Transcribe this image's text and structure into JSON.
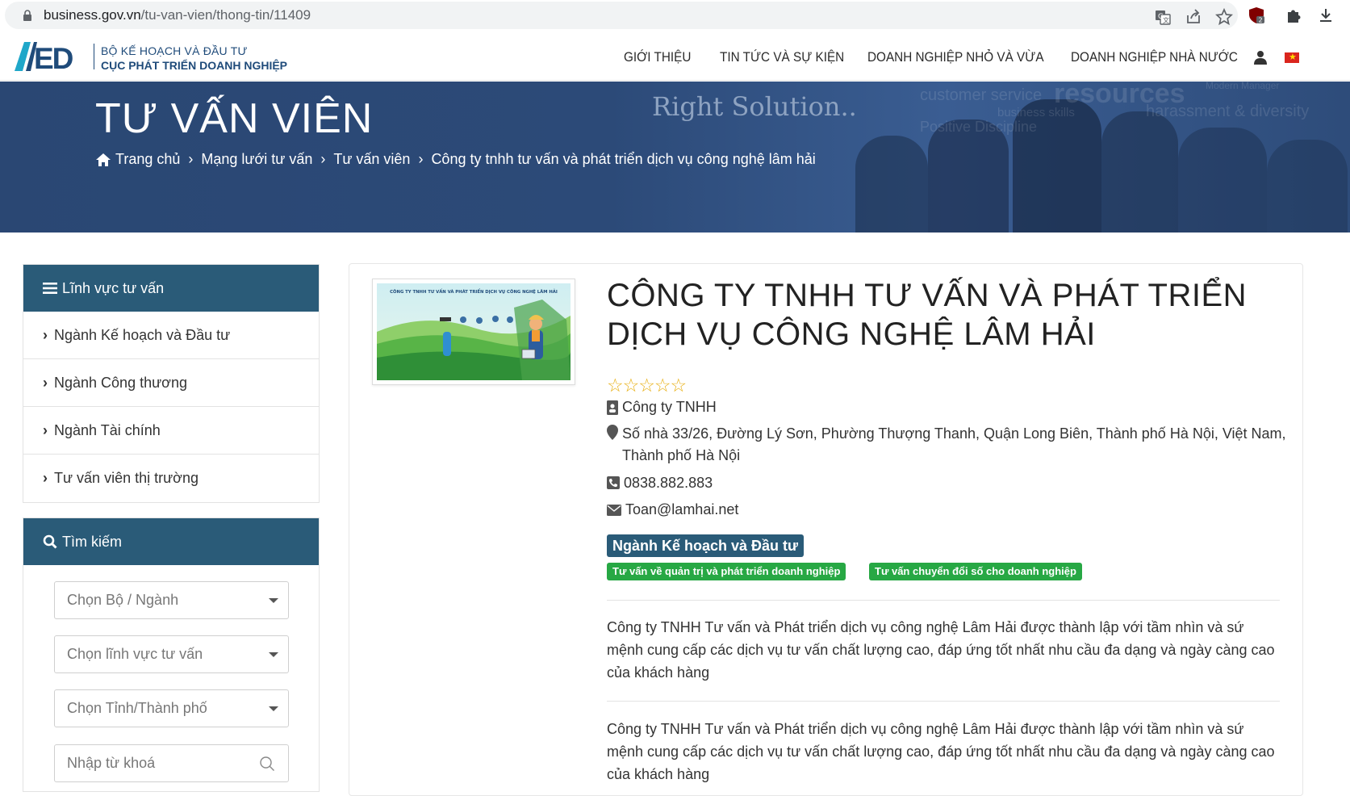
{
  "browser": {
    "url_host": "business.gov.vn",
    "url_path": "/tu-van-vien/thong-tin/11409"
  },
  "header": {
    "logo_line1": "BỘ KẾ HOẠCH VÀ ĐẦU TƯ",
    "logo_line2": "CỤC PHÁT TRIỂN DOANH NGHIỆP",
    "nav": [
      "GIỚI THIỆU",
      "TIN TỨC VÀ SỰ KIỆN",
      "DOANH NGHIỆP NHỎ VÀ VỪA",
      "DOANH NGHIỆP NHÀ NƯỚC"
    ]
  },
  "banner": {
    "title": "TƯ VẤN VIÊN",
    "tagline": "Right Solution..",
    "bg_words": [
      "customer service",
      "resources",
      "business skills",
      "Positive Discipline",
      "harassment & diversity",
      "Modern Manager"
    ],
    "breadcrumb": [
      "Trang chủ",
      "Mạng lưới tư vấn",
      "Tư vấn viên",
      "Công ty tnhh tư vấn và phát triển dịch vụ công nghệ lâm hải"
    ],
    "separator": "›"
  },
  "sidebar": {
    "fields_title": "Lĩnh vực tư vấn",
    "fields": [
      "Ngành Kế hoạch và Đầu tư",
      "Ngành Công thương",
      "Ngành Tài chính",
      "Tư vấn viên thị trường"
    ],
    "search_title": "Tìm kiếm",
    "select_ministry": "Chọn Bộ / Ngành",
    "select_field": "Chọn lĩnh vực tư vấn",
    "select_province": "Chọn Tỉnh/Thành phố",
    "keyword_placeholder": "Nhập từ khoá"
  },
  "company": {
    "name": "CÔNG TY TNHH TƯ VẤN VÀ PHÁT TRIỂN DỊCH VỤ CÔNG NGHỆ LÂM HẢI",
    "stars": "☆☆☆☆☆",
    "type": "Công ty TNHH",
    "address": "Số nhà 33/26, Đường Lý Sơn, Phường Thượng Thanh, Quận Long Biên, Thành phố Hà Nội, Việt Nam, Thành phố Hà Nội",
    "phone": "0838.882.883",
    "email": "Toan@lamhai.net",
    "sector": "Ngành Kế hoạch và Đầu tư",
    "services": [
      "Tư vấn về quản trị và phát triển doanh nghiệp",
      "Tư vấn chuyển đổi số cho doanh nghiệp"
    ],
    "description_1": "Công ty TNHH Tư vấn và Phát triển dịch vụ công nghệ Lâm Hải được thành lập với tầm nhìn và sứ mệnh cung cấp các dịch vụ tư vấn chất lượng cao, đáp ứng tốt nhất nhu cầu đa dạng và ngày càng cao của khách hàng",
    "description_2": "Công ty TNHH Tư vấn và Phát triển dịch vụ công nghệ Lâm Hải được thành lập với tầm nhìn và sứ mệnh cung cấp các dịch vụ tư vấn chất lượng cao, đáp ứng tốt nhất nhu cầu đa dạng và ngày càng cao của khách hàng",
    "thumb_caption": "CÔNG TY TNHH TƯ VẤN VÀ PHÁT TRIỂN DỊCH VỤ CÔNG NGHỆ LÂM HẢI"
  },
  "colors": {
    "brand_navy": "#2a4773",
    "panel_head": "#2a5b78",
    "tag_green": "#27a844",
    "star": "#e8b015"
  }
}
